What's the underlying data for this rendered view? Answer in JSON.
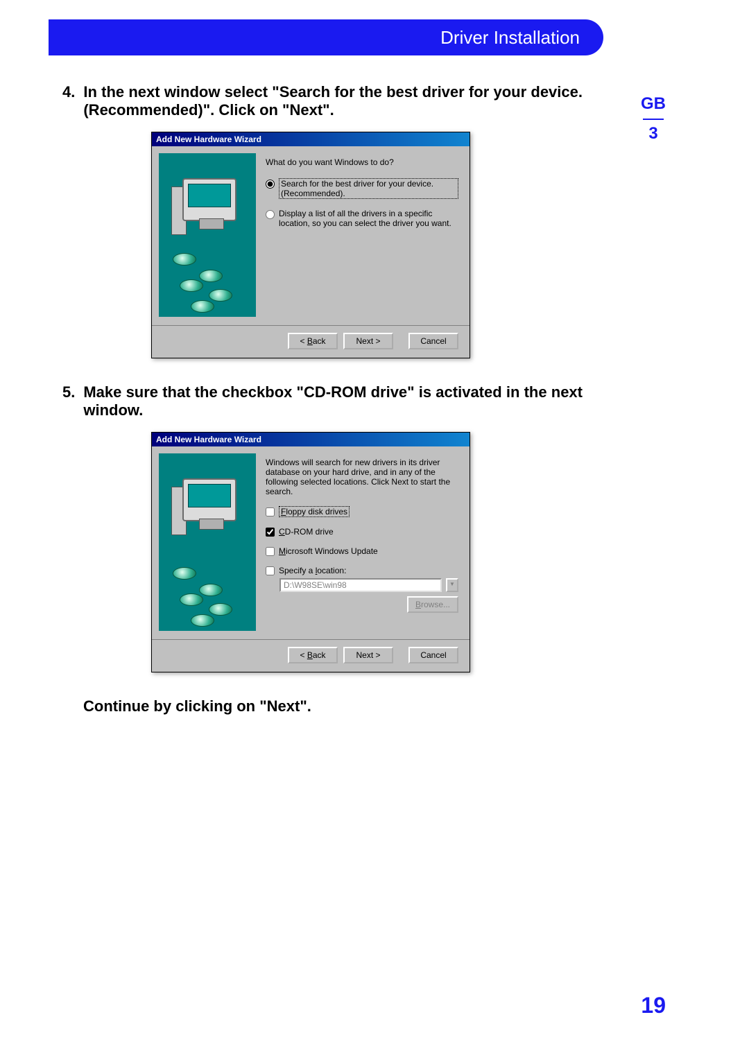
{
  "header": {
    "title": "Driver Installation"
  },
  "side": {
    "lang": "GB",
    "section": "3"
  },
  "page_number": "19",
  "steps": {
    "s4": {
      "num": "4.",
      "text": "In the next window select \"Search for the best driver for your device. (Recommended)\". Click on \"Next\"."
    },
    "s5": {
      "num": "5.",
      "text": "Make sure that the checkbox \"CD-ROM drive\" is activated in the next window."
    }
  },
  "continue_text": "Continue by clicking on \"Next\".",
  "wizard1": {
    "title": "Add New Hardware Wizard",
    "question": "What do you want Windows to do?",
    "option1_a": "Search for the best driver for your device.",
    "option1_b": "(Recommended).",
    "option2_a": "Display a list of all the drivers in a specific",
    "option2_b": "location, so you can select the driver you want.",
    "back": "< Back",
    "next": "Next >",
    "cancel": "Cancel"
  },
  "wizard2": {
    "title": "Add New Hardware Wizard",
    "intro": "Windows will search for new drivers in its driver database on your hard drive, and in any of the following selected locations. Click Next to start the search.",
    "cb_floppy_pre": "F",
    "cb_floppy_rest": "loppy disk drives",
    "cb_cdrom_pre": "C",
    "cb_cdrom_rest": "D-ROM drive",
    "cb_mwu_pre": "M",
    "cb_mwu_rest": "icrosoft Windows Update",
    "cb_loc_label_a": "Specify a ",
    "cb_loc_pre": "l",
    "cb_loc_label_b": "ocation:",
    "loc_value": "D:\\W98SE\\win98",
    "browse_pre": "B",
    "browse_rest": "rowse...",
    "back_pre": "B",
    "back_rest": "ack",
    "next": "Next >",
    "cancel": "Cancel"
  }
}
